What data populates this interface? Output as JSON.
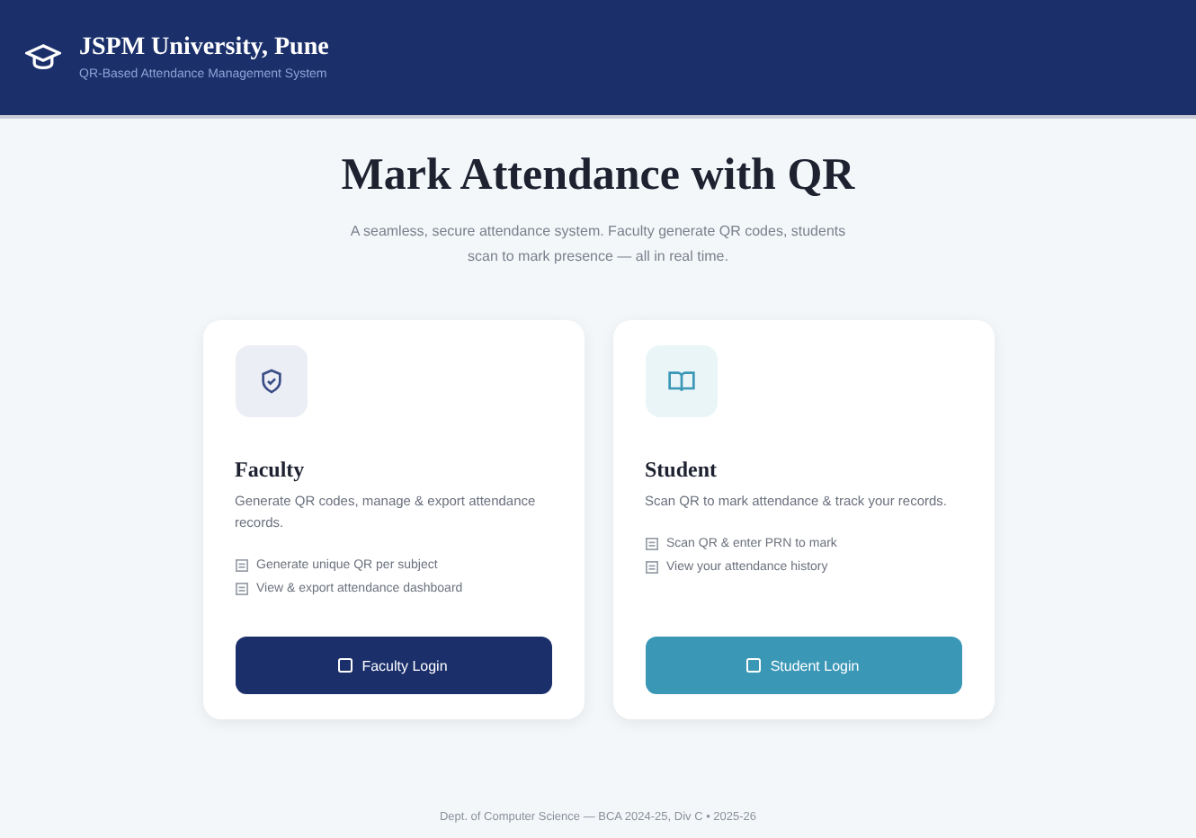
{
  "header": {
    "title": "JSPM University, Pune",
    "subtitle": "QR-Based Attendance Management System"
  },
  "hero": {
    "title": "Mark Attendance with QR",
    "description": "A seamless, secure attendance system. Faculty generate QR codes, students scan to mark presence — all in real time."
  },
  "cards": [
    {
      "kind": "faculty",
      "title": "Faculty",
      "description": "Generate QR codes, manage & export attendance records.",
      "features": [
        "Generate unique QR per subject",
        "View & export attendance dashboard"
      ],
      "button": "Faculty Login"
    },
    {
      "kind": "student",
      "title": "Student",
      "description": "Scan QR to mark attendance & track your records.",
      "features": [
        "Scan QR & enter PRN to mark",
        "View your attendance history"
      ],
      "button": "Student Login"
    }
  ],
  "footer": "Dept. of Computer Science — BCA 2024-25, Div C • 2025-26"
}
